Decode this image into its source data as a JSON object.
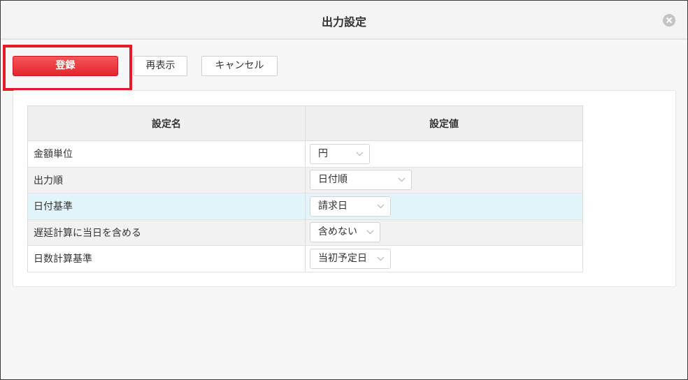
{
  "dialog": {
    "title": "出力設定"
  },
  "toolbar": {
    "register_label": "登録",
    "reload_label": "再表示",
    "cancel_label": "キャンセル"
  },
  "table": {
    "headers": {
      "name": "設定名",
      "value": "設定値"
    },
    "rows": [
      {
        "name": "金額単位",
        "value": "円"
      },
      {
        "name": "出力順",
        "value": "日付順"
      },
      {
        "name": "日付基準",
        "value": "請求日"
      },
      {
        "name": "遅延計算に当日を含める",
        "value": "含めない"
      },
      {
        "name": "日数計算基準",
        "value": "当初予定日"
      }
    ]
  },
  "colors": {
    "primary_button": "#e2262d",
    "highlight_border": "#e31b23",
    "active_row": "#e3f5fb"
  },
  "icons": {
    "close": "close-circle-icon",
    "dropdown": "chevron-down-icon"
  }
}
